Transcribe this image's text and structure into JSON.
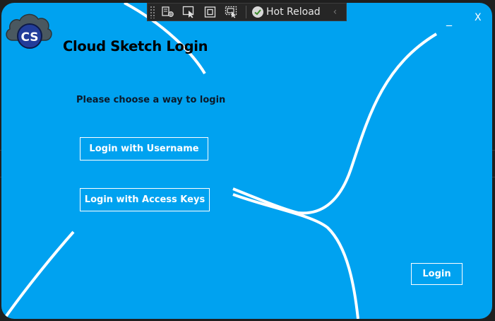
{
  "app": {
    "title": "Cloud Sketch Login",
    "logo_text": "CS",
    "subtitle": "Please choose a way to login"
  },
  "buttons": {
    "username": "Login with Username",
    "access_keys": "Login with Access Keys",
    "login": "Login"
  },
  "window_controls": {
    "minimize": "_",
    "close": "X"
  },
  "debug_toolbar": {
    "hot_reload_label": "Hot Reload",
    "icons": [
      "live-visual-tree-icon",
      "select-element-icon",
      "display-layout-adorners-icon",
      "track-focused-element-icon"
    ]
  },
  "colors": {
    "window_background": "#00a2f0",
    "accent_line": "#ffffff",
    "toolbar_background": "#262626"
  }
}
